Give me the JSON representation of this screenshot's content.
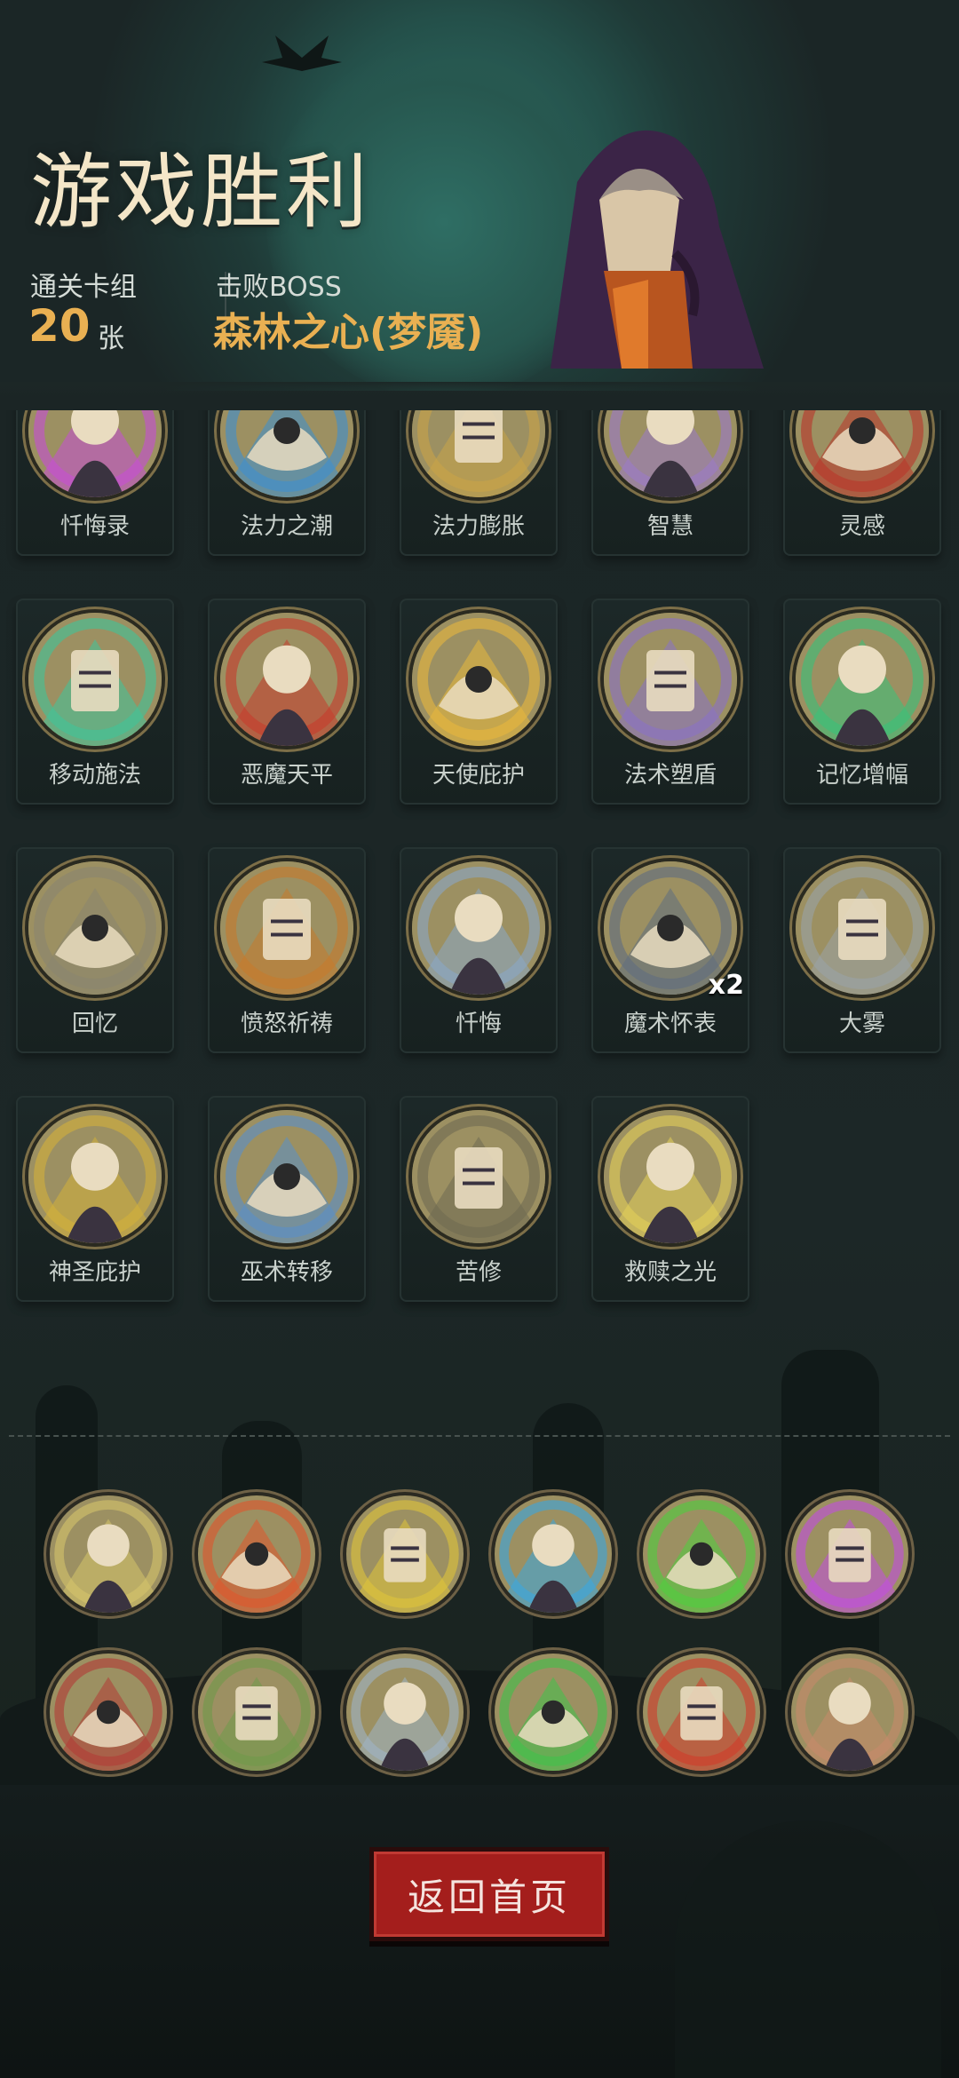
{
  "header": {
    "title": "游戏胜利",
    "deck_label": "通关卡组",
    "deck_count": "20",
    "deck_unit": "张",
    "boss_label": "击败BOSS",
    "boss_name": "森林之心(梦魇)"
  },
  "cards": [
    {
      "name": "忏悔录",
      "icon": "book-icon",
      "color": "#c64fd6"
    },
    {
      "name": "法力之潮",
      "icon": "wave-icon",
      "color": "#3d8fd1"
    },
    {
      "name": "法力膨胀",
      "icon": "mage-icon",
      "color": "#c9a448"
    },
    {
      "name": "智慧",
      "icon": "scholar-icon",
      "color": "#9b7ac9"
    },
    {
      "name": "灵感",
      "icon": "skull-icon",
      "color": "#b9352a"
    },
    {
      "name": "移动施法",
      "icon": "witch-icon",
      "color": "#3fc49a"
    },
    {
      "name": "恶魔天平",
      "icon": "demon-icon",
      "color": "#c63a2c"
    },
    {
      "name": "天使庇护",
      "icon": "wings-icon",
      "color": "#e7b83d"
    },
    {
      "name": "法术塑盾",
      "icon": "shield-spell-icon",
      "color": "#8a72c7"
    },
    {
      "name": "记忆增幅",
      "icon": "brain-icon",
      "color": "#39c27a"
    },
    {
      "name": "回忆",
      "icon": "old-man-icon",
      "color": "#8b8570"
    },
    {
      "name": "愤怒祈祷",
      "icon": "lion-icon",
      "color": "#c77a2c"
    },
    {
      "name": "忏悔",
      "icon": "cross-icon",
      "color": "#8ba7c6"
    },
    {
      "name": "魔术怀表",
      "icon": "pocket-watch-icon",
      "color": "#5f6d80",
      "multiplier": "x2"
    },
    {
      "name": "大雾",
      "icon": "fog-icon",
      "color": "#9aa3a6"
    },
    {
      "name": "神圣庇护",
      "icon": "holy-shield-icon",
      "color": "#d4b13a"
    },
    {
      "name": "巫术转移",
      "icon": "wizard-icon",
      "color": "#5a90c9"
    },
    {
      "name": "苦修",
      "icon": "monk-icon",
      "color": "#6f6a52"
    },
    {
      "name": "救赎之光",
      "icon": "light-icon",
      "color": "#e3cf59"
    }
  ],
  "relics_row1": [
    {
      "icon": "angel-relic-icon",
      "color": "#d6c46a"
    },
    {
      "icon": "bard-skull-red-icon",
      "color": "#e0552b"
    },
    {
      "icon": "bard-skull-yellow-icon",
      "color": "#e0c43a"
    },
    {
      "icon": "bard-skull-blue-icon",
      "color": "#3aa7e0"
    },
    {
      "icon": "bard-skull-green-icon",
      "color": "#4fcf3e"
    },
    {
      "icon": "bard-skull-purple-icon",
      "color": "#c24ee0"
    }
  ],
  "relics_row2": [
    {
      "icon": "throne-relic-icon",
      "color": "#b33a35"
    },
    {
      "icon": "ogre-relic-icon",
      "color": "#6f9a4a"
    },
    {
      "icon": "dagger-relic-icon",
      "color": "#9fb4c6"
    },
    {
      "icon": "ghost-relic-icon",
      "color": "#3fc24a"
    },
    {
      "icon": "red-demon-relic-icon",
      "color": "#d13a2a"
    },
    {
      "icon": "brute-relic-icon",
      "color": "#c78a6a"
    }
  ],
  "button": {
    "label": "返回首页"
  },
  "colors": {
    "accent": "#e9b052",
    "button": "#a41e1c"
  }
}
